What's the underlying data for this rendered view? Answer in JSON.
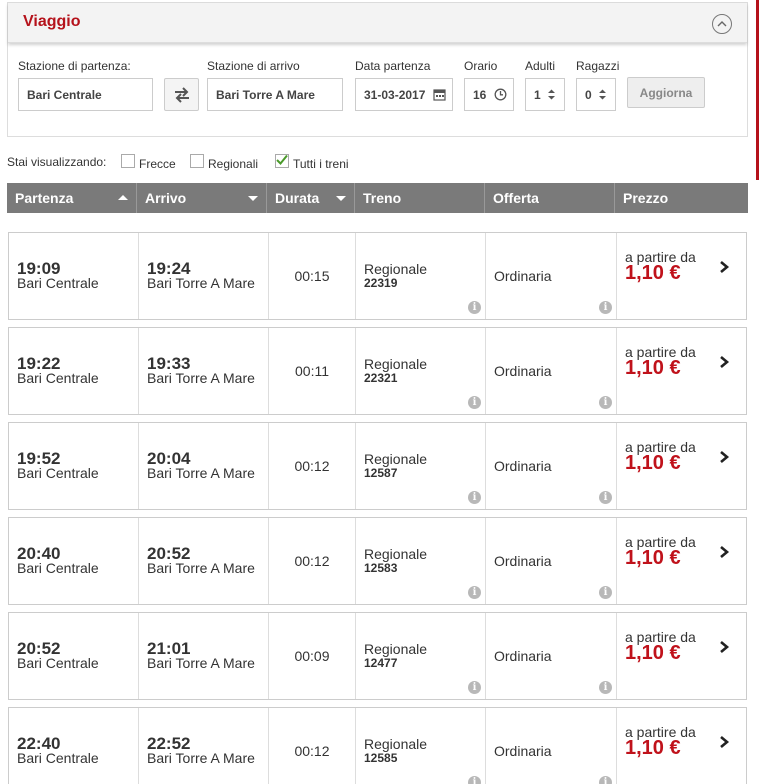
{
  "panel": {
    "title": "Viaggio",
    "departure_label": "Stazione di partenza:",
    "departure_value": "Bari Centrale",
    "arrival_label": "Stazione di arrivo",
    "arrival_value": "Bari Torre A Mare",
    "date_label": "Data partenza",
    "date_value": "31-03-2017",
    "time_label": "Orario",
    "time_value": "16",
    "adults_label": "Adulti",
    "adults_value": "1",
    "kids_label": "Ragazzi",
    "kids_value": "0",
    "update_label": "Aggiorna"
  },
  "filters": {
    "label": "Stai visualizzando:",
    "options": [
      {
        "label": "Frecce",
        "checked": false
      },
      {
        "label": "Regionali",
        "checked": false
      },
      {
        "label": "Tutti i treni",
        "checked": true
      }
    ]
  },
  "table": {
    "headers": [
      "Partenza",
      "Arrivo",
      "Durata",
      "Treno",
      "Offerta",
      "Prezzo"
    ],
    "rows": [
      {
        "dep_time": "19:09",
        "dep_station": "Bari Centrale",
        "arr_time": "19:24",
        "arr_station": "Bari Torre A Mare",
        "duration": "00:15",
        "train_type": "Regionale",
        "train_num": "22319",
        "offer": "Ordinaria",
        "price_from": "a partire da",
        "price": "1,10 €"
      },
      {
        "dep_time": "19:22",
        "dep_station": "Bari Centrale",
        "arr_time": "19:33",
        "arr_station": "Bari Torre A Mare",
        "duration": "00:11",
        "train_type": "Regionale",
        "train_num": "22321",
        "offer": "Ordinaria",
        "price_from": "a partire da",
        "price": "1,10 €"
      },
      {
        "dep_time": "19:52",
        "dep_station": "Bari Centrale",
        "arr_time": "20:04",
        "arr_station": "Bari Torre A Mare",
        "duration": "00:12",
        "train_type": "Regionale",
        "train_num": "12587",
        "offer": "Ordinaria",
        "price_from": "a partire da",
        "price": "1,10 €"
      },
      {
        "dep_time": "20:40",
        "dep_station": "Bari Centrale",
        "arr_time": "20:52",
        "arr_station": "Bari Torre A Mare",
        "duration": "00:12",
        "train_type": "Regionale",
        "train_num": "12583",
        "offer": "Ordinaria",
        "price_from": "a partire da",
        "price": "1,10 €"
      },
      {
        "dep_time": "20:52",
        "dep_station": "Bari Centrale",
        "arr_time": "21:01",
        "arr_station": "Bari Torre A Mare",
        "duration": "00:09",
        "train_type": "Regionale",
        "train_num": "12477",
        "offer": "Ordinaria",
        "price_from": "a partire da",
        "price": "1,10 €"
      },
      {
        "dep_time": "22:40",
        "dep_station": "Bari Centrale",
        "arr_time": "22:52",
        "arr_station": "Bari Torre A Mare",
        "duration": "00:12",
        "train_type": "Regionale",
        "train_num": "12585",
        "offer": "Ordinaria",
        "price_from": "a partire da",
        "price": "1,10 €"
      }
    ]
  },
  "colors": {
    "accent": "#b5121b",
    "price": "#c0121b",
    "header_bg": "#7a7a7a"
  }
}
